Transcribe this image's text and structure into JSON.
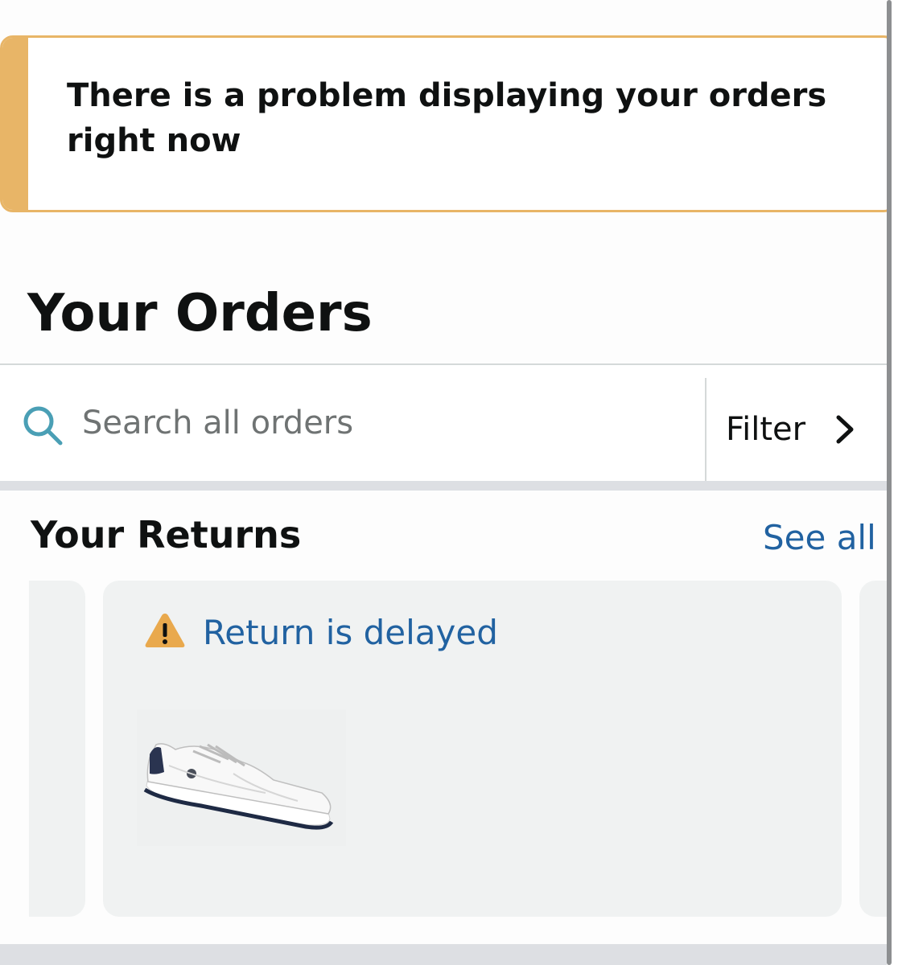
{
  "alert": {
    "message": "There is a problem displaying your orders right now"
  },
  "page": {
    "title": "Your Orders"
  },
  "search": {
    "placeholder": "Search all orders",
    "icon": "search-icon"
  },
  "filter": {
    "label": "Filter",
    "icon": "chevron-right-icon"
  },
  "returns": {
    "title": "Your Returns",
    "see_all": "See all",
    "cards": [
      {
        "status": "Return is delayed",
        "status_icon": "warning-icon",
        "product_image": "white-sneaker"
      }
    ]
  },
  "colors": {
    "alert_border": "#e8b567",
    "link": "#2162a1",
    "search_icon": "#4a9fb5",
    "card_bg": "#f0f2f2"
  }
}
